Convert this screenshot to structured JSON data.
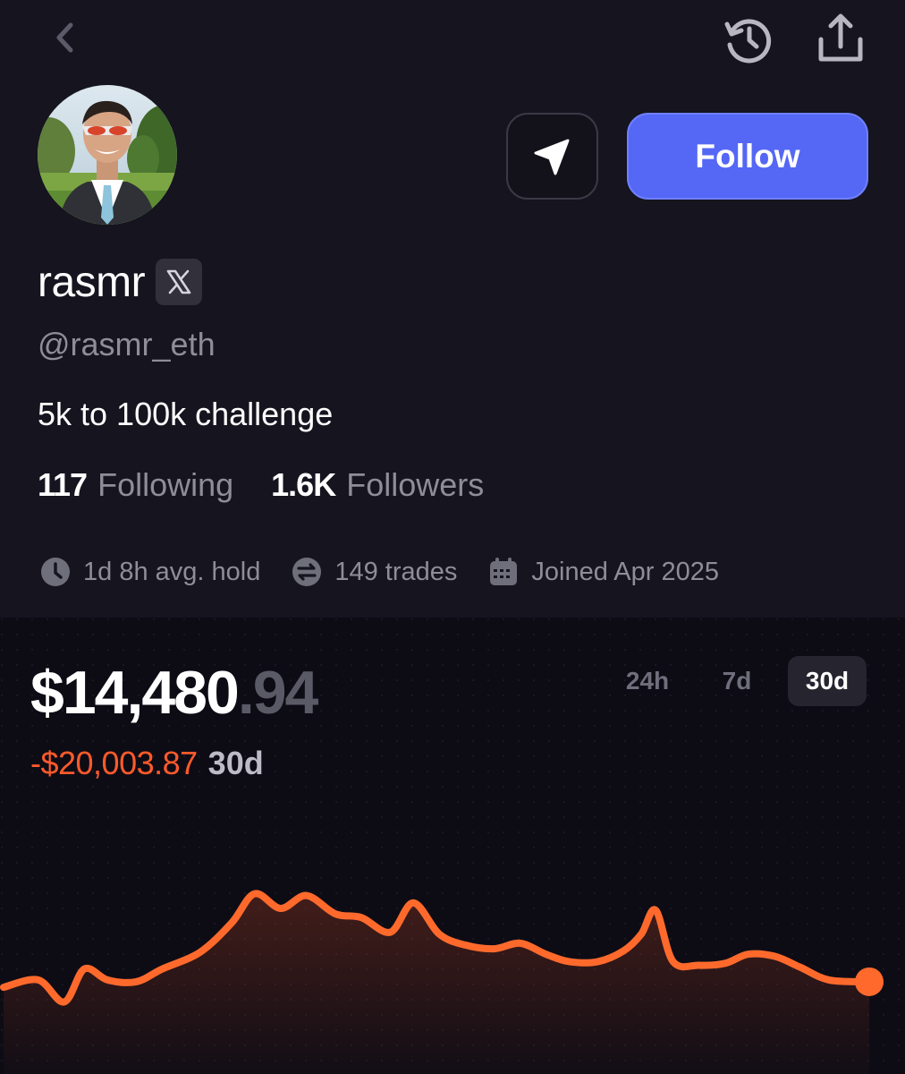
{
  "profile": {
    "display_name": "rasmr",
    "handle": "@rasmr_eth",
    "bio": "5k to 100k challenge",
    "follow_label": "Follow"
  },
  "stats": {
    "following_count": "117",
    "following_label": "Following",
    "followers_count": "1.6K",
    "followers_label": "Followers"
  },
  "meta": {
    "avg_hold": "1d 8h avg. hold",
    "trades": "149 trades",
    "joined": "Joined Apr 2025"
  },
  "portfolio": {
    "balance_whole": "$14,480",
    "balance_cents": ".94",
    "change_value": "-$20,003.87",
    "change_period": "30d",
    "ranges": [
      "24h",
      "7d",
      "30d"
    ],
    "selected_range": "30d"
  },
  "icons": {
    "back": "chevron-left-icon",
    "history": "history-icon",
    "share": "share-icon",
    "message": "send-icon",
    "x_badge": "x-logo-icon",
    "avg_hold": "clock-icon",
    "trades": "swap-icon",
    "joined": "calendar-icon"
  },
  "colors": {
    "background": "#15141f",
    "chart_background": "#0d0c15",
    "accent": "#5467f5",
    "negative": "#ff5a2b",
    "muted": "#8e8d99"
  },
  "chart_data": {
    "type": "line",
    "title": "",
    "xlabel": "",
    "ylabel": "",
    "range": "30d",
    "points": [
      [
        0,
        18
      ],
      [
        1.2,
        22
      ],
      [
        2.1,
        10
      ],
      [
        2.8,
        28
      ],
      [
        3.6,
        22
      ],
      [
        4.6,
        21
      ],
      [
        5.5,
        28
      ],
      [
        6.8,
        37
      ],
      [
        7.9,
        53
      ],
      [
        8.7,
        69
      ],
      [
        9.6,
        61
      ],
      [
        10.5,
        68
      ],
      [
        11.5,
        58
      ],
      [
        12.4,
        56
      ],
      [
        13.4,
        48
      ],
      [
        14.2,
        64
      ],
      [
        15.1,
        47
      ],
      [
        16.0,
        41
      ],
      [
        17.0,
        39
      ],
      [
        17.9,
        42
      ],
      [
        18.8,
        36
      ],
      [
        19.6,
        32
      ],
      [
        20.6,
        32
      ],
      [
        21.5,
        38
      ],
      [
        22.1,
        47
      ],
      [
        22.6,
        60
      ],
      [
        23.2,
        32
      ],
      [
        24.1,
        30
      ],
      [
        25.0,
        31
      ],
      [
        25.8,
        36
      ],
      [
        26.7,
        35
      ],
      [
        27.6,
        29
      ],
      [
        28.6,
        22
      ],
      [
        30,
        21
      ]
    ],
    "ylim": [
      0,
      100
    ],
    "xlim": [
      0,
      30
    ],
    "color": "#ff6a2c",
    "grid": false
  }
}
